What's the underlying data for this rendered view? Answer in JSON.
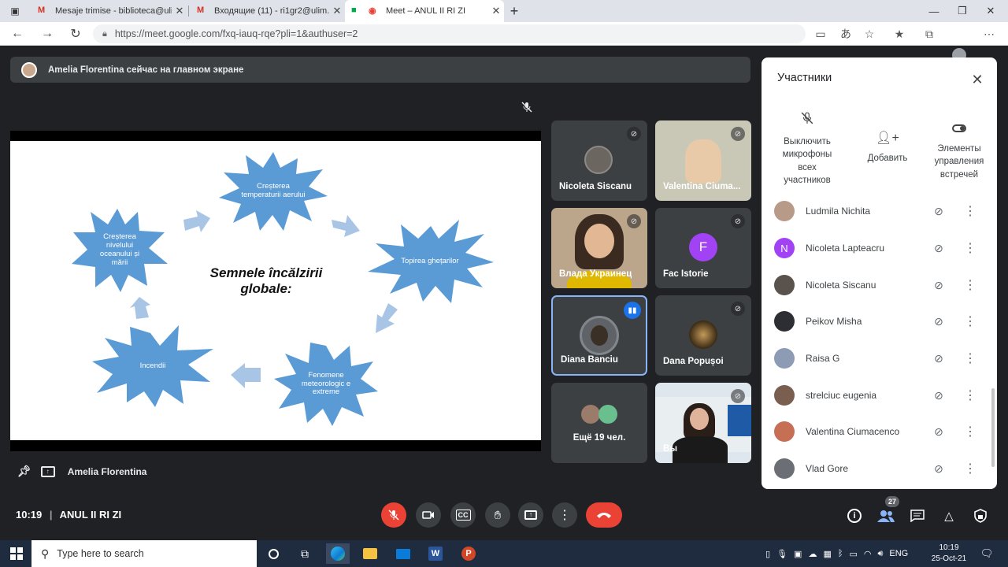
{
  "browser": {
    "tabs": [
      {
        "title": "Mesaje trimise - biblioteca@ulim",
        "icon": "gmail-icon"
      },
      {
        "title": "Входящие (11) - ri1gr2@ulim.m",
        "icon": "gmail-icon"
      },
      {
        "title": "Meet – ANUL II RI ZI",
        "icon": "meet-icon",
        "active": true
      }
    ],
    "url": "https://meet.google.com/fxq-iauq-rqe?pli=1&authuser=2"
  },
  "meet": {
    "banner": "Amelia Florentina сейчас на главном экране",
    "slide": {
      "title": "Semnele încălzirii globale:",
      "bursts": [
        "Creșterea temperaturii aerului",
        "Topirea ghețarilor",
        "Fenomene meteorologic e extreme",
        "Incendii",
        "Creșterea nivelului oceanului și mării"
      ]
    },
    "tiles": [
      {
        "name": "Nicoleta Siscanu"
      },
      {
        "name": "Valentina Ciumacenco",
        "display": "Valentina Ciuma..."
      },
      {
        "name": "Влада Украинец"
      },
      {
        "name": "Fac Istorie",
        "initial": "F"
      },
      {
        "name": "Diana Banciu"
      },
      {
        "name": "Dana Popușoi"
      },
      {
        "name": "Ещё 19 чел."
      },
      {
        "name": "Вы"
      }
    ],
    "presenter": "Amelia Florentina",
    "time": "10:19",
    "meeting_name": "ANUL II RI ZI",
    "participant_count": "27"
  },
  "panel": {
    "title": "Участники",
    "actions": {
      "mute_all": "Выключить микрофоны всех участников",
      "add": "Добавить",
      "controls": "Элементы управления встречей"
    },
    "participants": [
      {
        "name": "Ludmila Nichita"
      },
      {
        "name": "Nicoleta Lapteacru",
        "initial": "N"
      },
      {
        "name": "Nicoleta Siscanu"
      },
      {
        "name": "Peikov Misha"
      },
      {
        "name": "Raisa G"
      },
      {
        "name": "strelciuc eugenia"
      },
      {
        "name": "Valentina Ciumacenco"
      },
      {
        "name": "Vlad Gore"
      }
    ]
  },
  "taskbar": {
    "search_placeholder": "Type here to search",
    "lang": "ENG",
    "time": "10:19",
    "date": "25-Oct-21"
  },
  "colors": {
    "burst": "#5b9bd5",
    "arrow": "#a9c5e6",
    "end_call": "#ea4335",
    "active_speaker": "#8ab4f8",
    "avatar_purple": "#a142f4"
  }
}
